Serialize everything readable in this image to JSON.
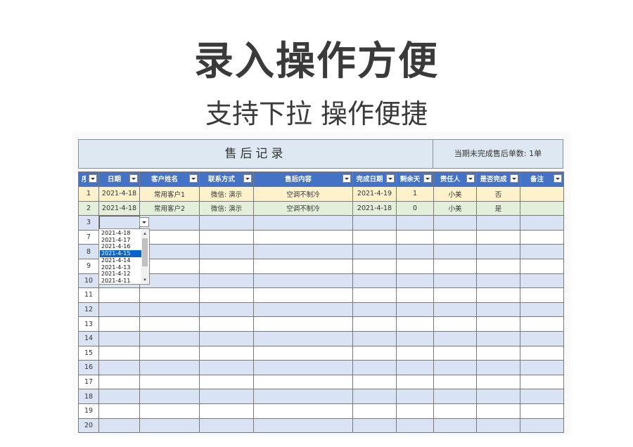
{
  "headline": "录入操作方便",
  "subheadline": "支持下拉 操作便捷",
  "banner": {
    "title": "售后记录",
    "stat": "当期未完成售后单数: 1单"
  },
  "columns": [
    "序",
    "日期",
    "客户姓名",
    "联系方式",
    "售后内容",
    "完成日期",
    "剩余天",
    "责任人",
    "是否完成",
    "备注"
  ],
  "rows": [
    {
      "style": "a",
      "cells": [
        "1",
        "2021-4-18",
        "常用客户1",
        "微信: 演示",
        "空调不制冷",
        "2021-4-19",
        "1",
        "小美",
        "否",
        ""
      ]
    },
    {
      "style": "b",
      "cells": [
        "2",
        "2021-4-18",
        "常用客户2",
        "微信: 演示",
        "空调不制冷",
        "2021-4-18",
        "0",
        "小美",
        "是",
        ""
      ]
    },
    {
      "style": "e",
      "cells": [
        "3",
        "",
        "",
        "",
        "",
        "",
        "",
        "",
        "",
        ""
      ]
    },
    {
      "style": "w",
      "cells": [
        "7",
        "",
        "",
        "",
        "",
        "",
        "",
        "",
        "",
        ""
      ]
    },
    {
      "style": "e",
      "cells": [
        "8",
        "",
        "",
        "",
        "",
        "",
        "",
        "",
        "",
        ""
      ]
    },
    {
      "style": "w",
      "cells": [
        "9",
        "",
        "",
        "",
        "",
        "",
        "",
        "",
        "",
        ""
      ]
    },
    {
      "style": "e",
      "cells": [
        "10",
        "",
        "",
        "",
        "",
        "",
        "",
        "",
        "",
        ""
      ]
    },
    {
      "style": "w",
      "cells": [
        "11",
        "",
        "",
        "",
        "",
        "",
        "",
        "",
        "",
        ""
      ]
    },
    {
      "style": "e",
      "cells": [
        "12",
        "",
        "",
        "",
        "",
        "",
        "",
        "",
        "",
        ""
      ]
    },
    {
      "style": "w",
      "cells": [
        "13",
        "",
        "",
        "",
        "",
        "",
        "",
        "",
        "",
        ""
      ]
    },
    {
      "style": "e",
      "cells": [
        "14",
        "",
        "",
        "",
        "",
        "",
        "",
        "",
        "",
        ""
      ]
    },
    {
      "style": "w",
      "cells": [
        "15",
        "",
        "",
        "",
        "",
        "",
        "",
        "",
        "",
        ""
      ]
    },
    {
      "style": "e",
      "cells": [
        "16",
        "",
        "",
        "",
        "",
        "",
        "",
        "",
        "",
        ""
      ]
    },
    {
      "style": "w",
      "cells": [
        "17",
        "",
        "",
        "",
        "",
        "",
        "",
        "",
        "",
        ""
      ]
    },
    {
      "style": "e",
      "cells": [
        "18",
        "",
        "",
        "",
        "",
        "",
        "",
        "",
        "",
        ""
      ]
    },
    {
      "style": "w",
      "cells": [
        "19",
        "",
        "",
        "",
        "",
        "",
        "",
        "",
        "",
        ""
      ]
    },
    {
      "style": "e",
      "cells": [
        "20",
        "",
        "",
        "",
        "",
        "",
        "",
        "",
        "",
        ""
      ]
    }
  ],
  "dropdown": {
    "options": [
      "2021-4-18",
      "2021-4-17",
      "2021-4-16",
      "2021-4-15",
      "2021-4-14",
      "2021-4-13",
      "2021-4-12",
      "2021-4-11"
    ],
    "selected": "2021-4-15"
  },
  "colors": {
    "header": "#4472c4",
    "row_pending": "#fdf2cc",
    "row_done": "#e3efdb",
    "row_stripe": "#dae3f3",
    "selection": "#0a64c8"
  }
}
